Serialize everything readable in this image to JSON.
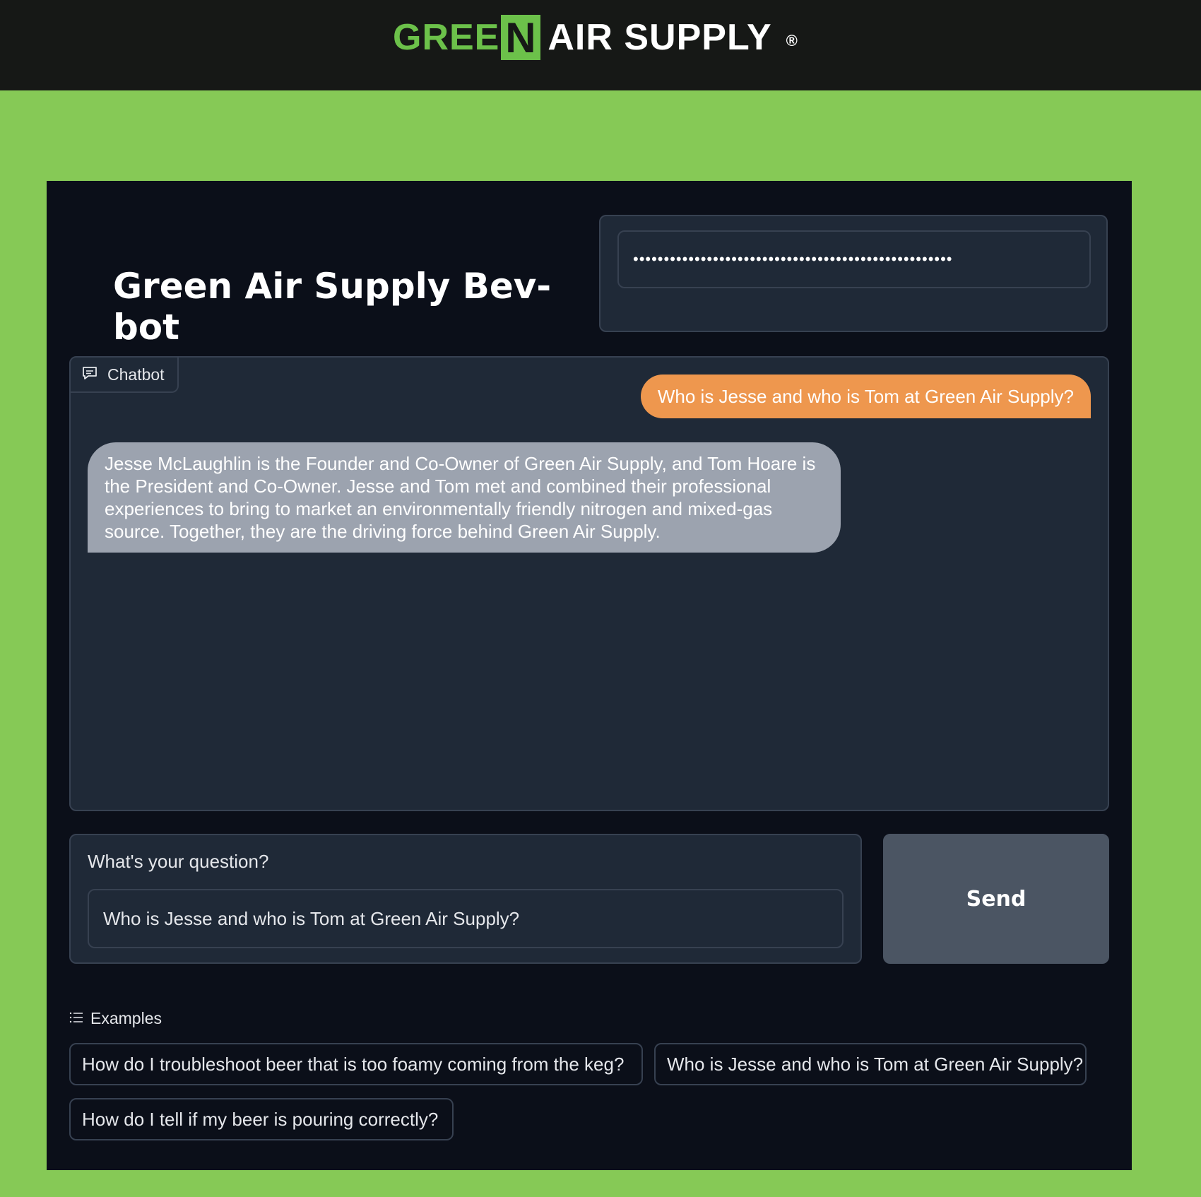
{
  "header": {
    "logo_green": "GREE",
    "logo_n": "N",
    "logo_white": "AIR SUPPLY",
    "logo_reg": "®"
  },
  "app": {
    "title": "Green Air Supply Bev-bot",
    "password_value": "••••••••••••••••••••••••••••••••••••••••••••••••••••"
  },
  "chatbot": {
    "label": "Chatbot",
    "messages": [
      {
        "role": "user",
        "text": "Who is Jesse and who is Tom at Green Air Supply?"
      },
      {
        "role": "bot",
        "text": "Jesse McLaughlin is the Founder and Co-Owner of Green Air Supply, and Tom Hoare is the President and Co-Owner. Jesse and Tom met and combined their professional experiences to bring to market an environmentally friendly nitrogen and mixed-gas source. Together, they are the driving force behind Green Air Supply."
      }
    ]
  },
  "question": {
    "label": "What's your question?",
    "value": "Who is Jesse and who is Tom at Green Air Supply?"
  },
  "send_label": "Send",
  "examples": {
    "label": "Examples",
    "items": [
      "How do I troubleshoot beer that is too foamy coming from the keg?",
      "Who is Jesse and who is Tom at Green Air Supply?",
      "How do I tell if my beer is pouring correctly?"
    ]
  },
  "colors": {
    "brand_green": "#86c956",
    "user_bubble": "#ee974e",
    "bot_bubble": "#9ca3af"
  }
}
